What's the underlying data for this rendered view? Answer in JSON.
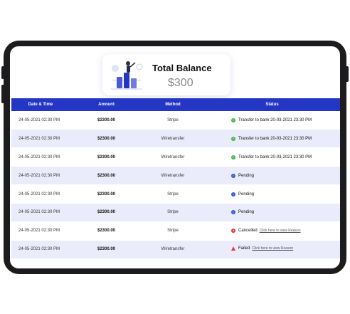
{
  "balance": {
    "title": "Total Balance",
    "amount": "$300"
  },
  "table": {
    "headers": {
      "date": "Date & Time",
      "amount": "Amount",
      "method": "Method",
      "status": "Status"
    },
    "rows": [
      {
        "date": "24-05-2021  02:30 PM",
        "amount": "$2300.00",
        "method": "Stripe",
        "status": "Transfer to bank 20-03-2021 23:30 PM",
        "status_type": "success",
        "link": ""
      },
      {
        "date": "24-05-2021  02:30 PM",
        "amount": "$2300.00",
        "method": "Wiretransfer",
        "status": "Transfer to bank 20-03-2021 23:30 PM",
        "status_type": "success",
        "link": ""
      },
      {
        "date": "24-05-2021  02:30 PM",
        "amount": "$2300.00",
        "method": "Wiretransfer",
        "status": "Transfer to bank 20-03-2021 23:30 PM",
        "status_type": "success",
        "link": ""
      },
      {
        "date": "24-05-2021  02:30 PM",
        "amount": "$2300.00",
        "method": "Wiretransfer",
        "status": "Pending",
        "status_type": "pending",
        "link": ""
      },
      {
        "date": "24-05-2021  02:30 PM",
        "amount": "$2300.00",
        "method": "Stripe",
        "status": "Pending",
        "status_type": "pending",
        "link": ""
      },
      {
        "date": "24-05-2021  02:30 PM",
        "amount": "$2300.00",
        "method": "Stripe",
        "status": "Pending",
        "status_type": "pending",
        "link": ""
      },
      {
        "date": "24-05-2021  02:30 PM",
        "amount": "$2300.00",
        "method": "Stripe",
        "status": "Cancelled",
        "status_type": "cancelled",
        "link": "Click here to view Reason"
      },
      {
        "date": "24-05-2021  02:30 PM",
        "amount": "$2300.00",
        "method": "Wiretransfer",
        "status": "Failed",
        "status_type": "failed",
        "link": "Click here to view Reason"
      }
    ]
  },
  "colors": {
    "header_bg": "#2336c4",
    "row_alt_bg": "#eaecfb",
    "success": "#43b649",
    "pending": "#2c5fd8",
    "cancelled": "#e53935",
    "failed": "#e53935",
    "device_frame": "#1c1c1e"
  },
  "icons": {
    "success": "check-circle-icon",
    "pending": "clock-circle-icon",
    "cancelled": "x-circle-icon",
    "failed": "warning-triangle-icon",
    "balance": "finance-illustration"
  }
}
